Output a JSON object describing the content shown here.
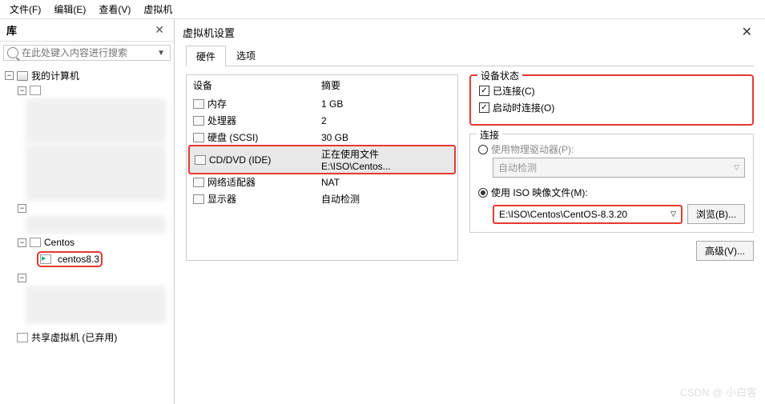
{
  "menubar": {
    "file": "文件(F)",
    "edit": "编辑(E)",
    "view": "查看(V)",
    "vm": "虚拟机"
  },
  "sidebar": {
    "title": "库",
    "search_placeholder": "在此处键入内容进行搜索",
    "my_computer": "我的计算机",
    "centos_folder": "Centos",
    "centos_vm": "centos8.3",
    "shared_vm": "共享虚拟机 (已弃用)"
  },
  "dialog": {
    "title": "虚拟机设置",
    "tabs": {
      "hardware": "硬件",
      "options": "选项"
    },
    "device_header": {
      "device": "设备",
      "summary": "摘要"
    },
    "devices": [
      {
        "name": "内存",
        "summary": "1 GB"
      },
      {
        "name": "处理器",
        "summary": "2"
      },
      {
        "name": "硬盘 (SCSI)",
        "summary": "30 GB"
      },
      {
        "name": "CD/DVD (IDE)",
        "summary": "正在使用文件 E:\\ISO\\Centos..."
      },
      {
        "name": "网络适配器",
        "summary": "NAT"
      },
      {
        "name": "显示器",
        "summary": "自动检测"
      }
    ],
    "status": {
      "title": "设备状态",
      "connected": "已连接(C)",
      "connect_at_start": "启动时连接(O)"
    },
    "connection": {
      "title": "连接",
      "physical": "使用物理驱动器(P):",
      "auto_detect": "自动检测",
      "use_iso": "使用 ISO 映像文件(M):",
      "iso_path": "E:\\ISO\\Centos\\CentOS-8.3.20",
      "browse": "浏览(B)..."
    },
    "advanced": "高级(V)..."
  },
  "watermark": "CSDN @ 小白客"
}
